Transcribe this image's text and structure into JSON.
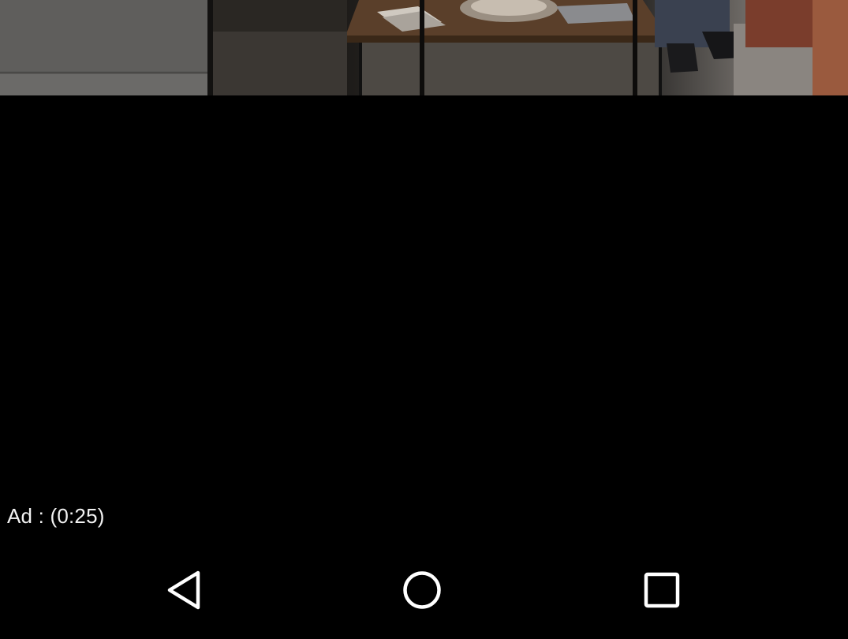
{
  "video": {
    "ad_timer_text": "Ad : (0:25)",
    "scene_icon": "living-room-video-frame"
  },
  "navbar": {
    "back_icon": "triangle-back",
    "home_icon": "circle-home",
    "recents_icon": "square-recents"
  },
  "colors": {
    "background": "#000000",
    "text": "#f2f2f2",
    "nav_icon": "#ffffff"
  }
}
